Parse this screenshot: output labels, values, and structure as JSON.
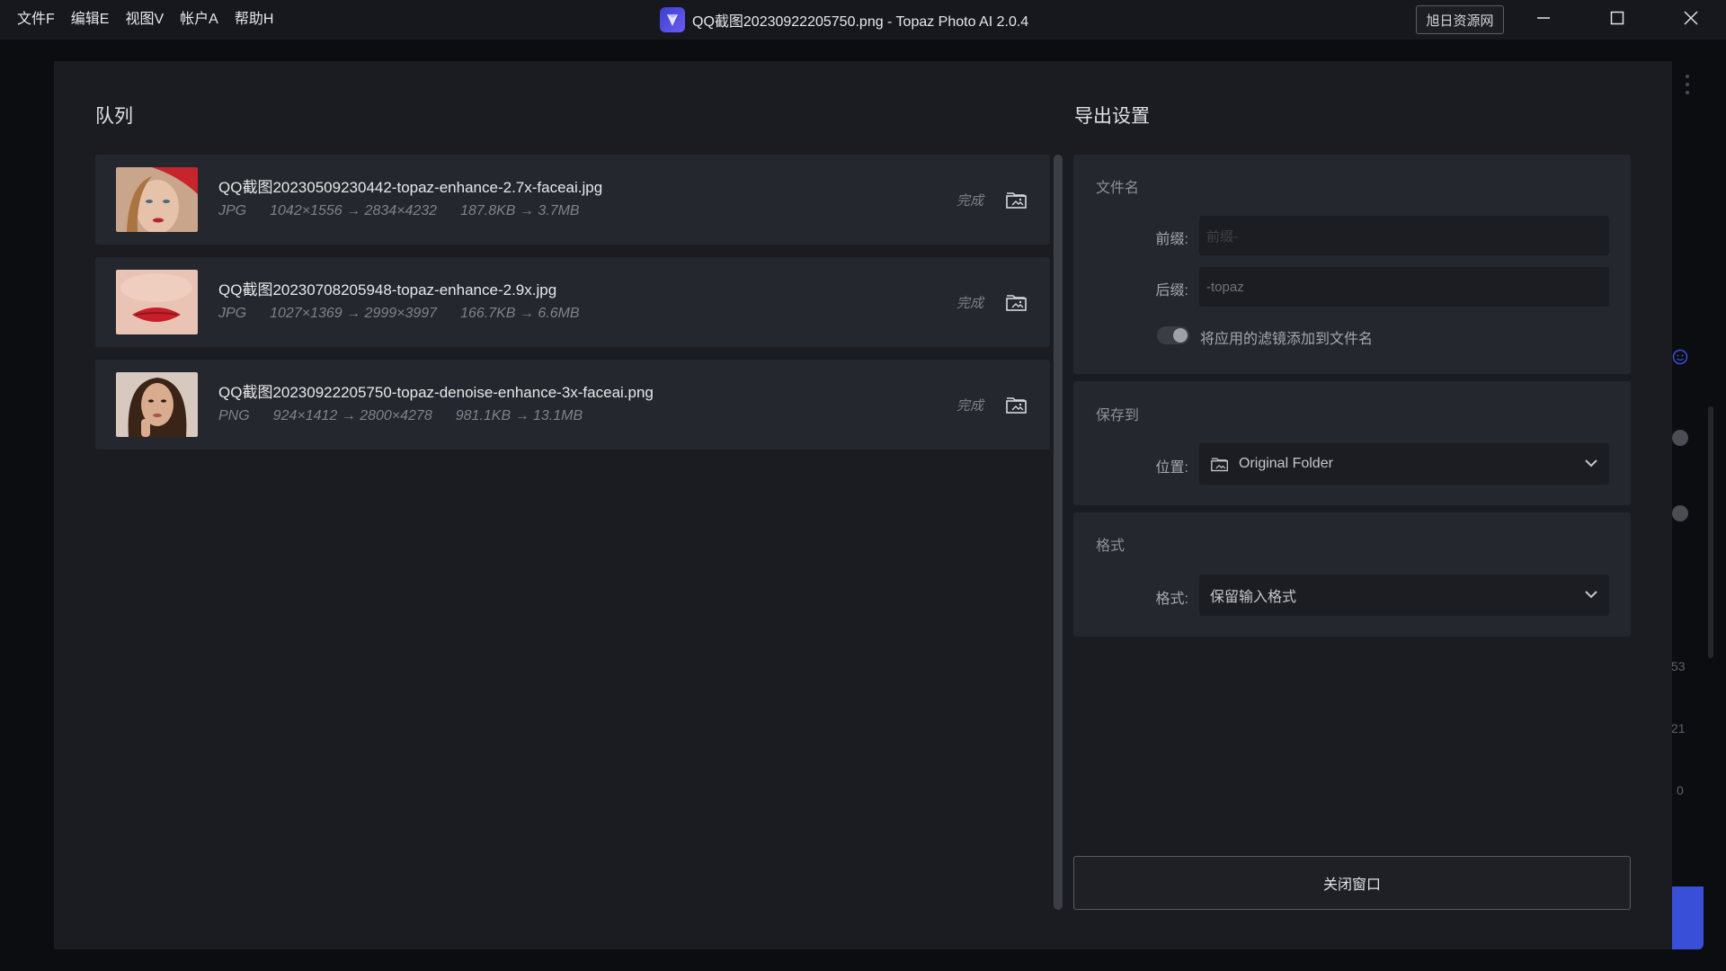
{
  "menu": {
    "items": [
      {
        "label": "文件F"
      },
      {
        "label": "编辑E"
      },
      {
        "label": "视图V"
      },
      {
        "label": "帐户A"
      },
      {
        "label": "帮助H"
      }
    ]
  },
  "window": {
    "title": "QQ截图20230922205750.png - Topaz Photo AI 2.0.4",
    "badge": "旭日资源网"
  },
  "background": {
    "numbers": [
      "53",
      "21",
      "0"
    ]
  },
  "queue": {
    "title": "队列",
    "items": [
      {
        "name": "QQ截图20230509230442-topaz-enhance-2.7x-faceai.jpg",
        "format": "JPG",
        "dimensions": "1042×1556 → 2834×4232",
        "size": "187.8KB → 3.7MB",
        "status": "完成"
      },
      {
        "name": "QQ截图20230708205948-topaz-enhance-2.9x.jpg",
        "format": "JPG",
        "dimensions": "1027×1369 → 2999×3997",
        "size": "166.7KB → 6.6MB",
        "status": "完成"
      },
      {
        "name": "QQ截图20230922205750-topaz-denoise-enhance-3x-faceai.png",
        "format": "PNG",
        "dimensions": "924×1412 → 2800×4278",
        "size": "981.1KB → 13.1MB",
        "status": "完成"
      }
    ]
  },
  "export": {
    "title": "导出设置",
    "filename": {
      "title": "文件名",
      "prefix_label": "前缀:",
      "prefix_placeholder": "前缀-",
      "suffix_label": "后缀:",
      "suffix_value": "-topaz",
      "toggle_label": "将应用的滤镜添加到文件名",
      "toggle_on": false
    },
    "save_to": {
      "title": "保存到",
      "location_label": "位置:",
      "location_value": "Original Folder"
    },
    "format": {
      "title": "格式",
      "format_label": "格式:",
      "format_value": "保留输入格式"
    },
    "close_button": "关闭窗口"
  },
  "colors": {
    "accent": "#3a4fd8",
    "panel": "#24272d",
    "dialog": "#1a1c21"
  }
}
